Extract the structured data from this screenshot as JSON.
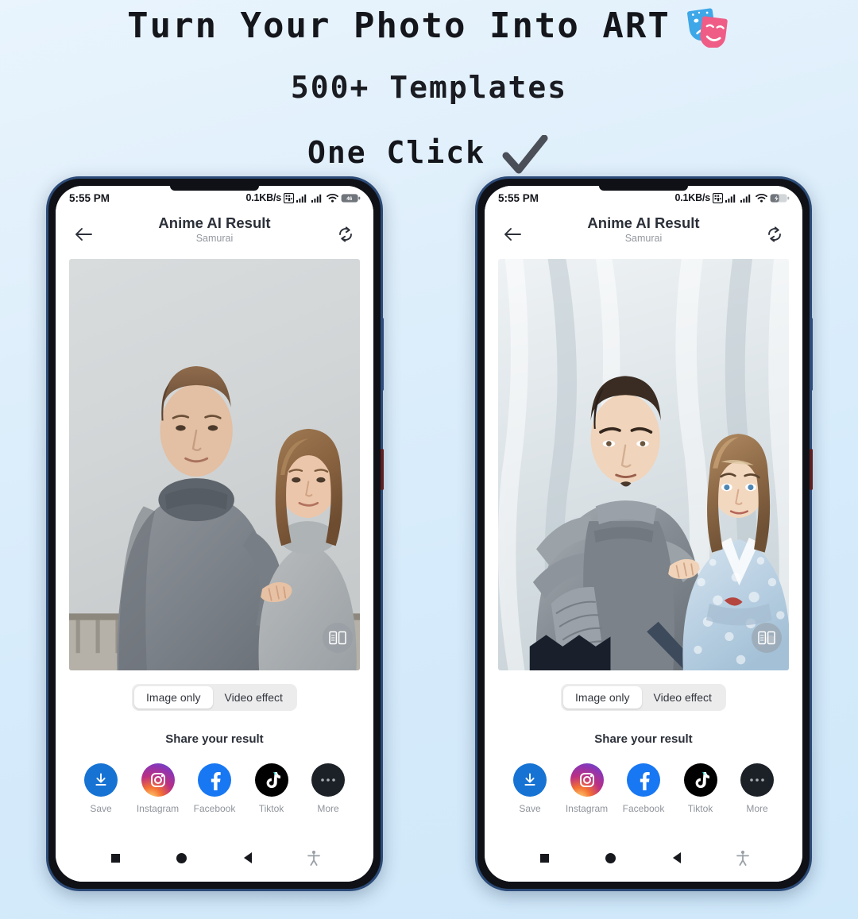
{
  "promo": {
    "line1": "Turn Your Photo Into ART",
    "line1_icon": "theatre-masks-icon",
    "line2": "500+ Templates",
    "line3": "One Click",
    "line3_icon": "checkmark-icon"
  },
  "statusbar": {
    "time": "5:55 PM",
    "net_speed": "0.1KB/s",
    "icons": [
      "sim-card-icon",
      "signal-bars-icon",
      "signal-bars-icon",
      "wifi-icon",
      "battery-icon"
    ],
    "battery_left": "46",
    "battery_right_state": "charging"
  },
  "appbar": {
    "back_icon": "back-arrow-icon",
    "title": "Anime AI Result",
    "subtitle": "Samurai",
    "refresh_icon": "refresh-icon"
  },
  "stage": {
    "compare_icon": "compare-split-icon",
    "left_caption": "original-photo",
    "right_caption": "anime-result-photo"
  },
  "segmented": {
    "items": [
      {
        "label": "Image only",
        "active": true
      },
      {
        "label": "Video effect",
        "active": false
      }
    ]
  },
  "share": {
    "title": "Share your result",
    "items": [
      {
        "label": "Save",
        "icon": "download-icon",
        "color": "#1673d4"
      },
      {
        "label": "Instagram",
        "icon": "instagram-icon",
        "color": "#bc3081"
      },
      {
        "label": "Facebook",
        "icon": "facebook-icon",
        "color": "#1877f2"
      },
      {
        "label": "Tiktok",
        "icon": "tiktok-icon",
        "color": "#010101"
      },
      {
        "label": "More",
        "icon": "more-dots-icon",
        "color": "#1c2128"
      }
    ]
  },
  "navbar": {
    "items": [
      "recents-square-icon",
      "home-circle-icon",
      "back-triangle-icon",
      "accessibility-icon"
    ]
  },
  "colors": {
    "background_top": "#e9f4fd",
    "background_bottom": "#cfe8fa",
    "phone_frame": "#2b4a77",
    "accent_blue": "#1877f2"
  }
}
